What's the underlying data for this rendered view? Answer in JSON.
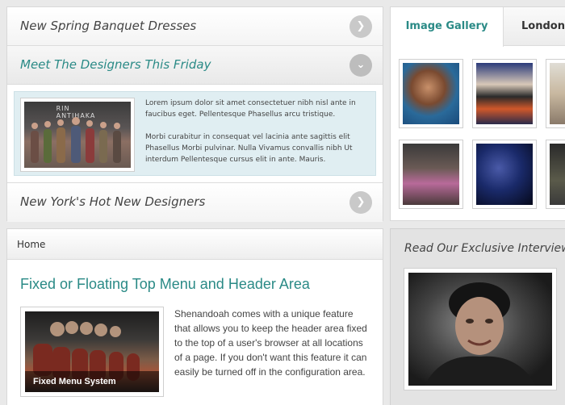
{
  "accordion": {
    "items": [
      {
        "title": "New Spring Banquet Dresses"
      },
      {
        "title": "Meet The Designers This Friday"
      },
      {
        "title": "New York's Hot New Designers"
      }
    ],
    "panel": {
      "image_text": "RIN ANTIHAKA",
      "paragraph1": "Lorem ipsum dolor sit amet consectetuer nibh nisl ante in faucibus eget. Pellentesque Phasellus arcu tristique.",
      "paragraph2": "Morbi curabitur in consequat vel lacinia ante sagittis elit Phasellus Morbi pulvinar. Nulla Vivamus convallis nibh Ut interdum Pellentesque cursus elit in ante. Mauris."
    }
  },
  "gallery": {
    "tabs": [
      {
        "label": "Image Gallery"
      },
      {
        "label": "London"
      }
    ]
  },
  "main": {
    "breadcrumb": "Home",
    "title": "Fixed or Floating Top Menu and Header Area",
    "image_caption": "Fixed Menu System",
    "body": "Shenandoah comes with a unique feature that allows you to keep the header area fixed to the top of a user's browser at all locations of a page. If you don't want this feature it can easily be turned off in the configuration area."
  },
  "interview": {
    "title": "Read Our Exclusive Interview"
  }
}
